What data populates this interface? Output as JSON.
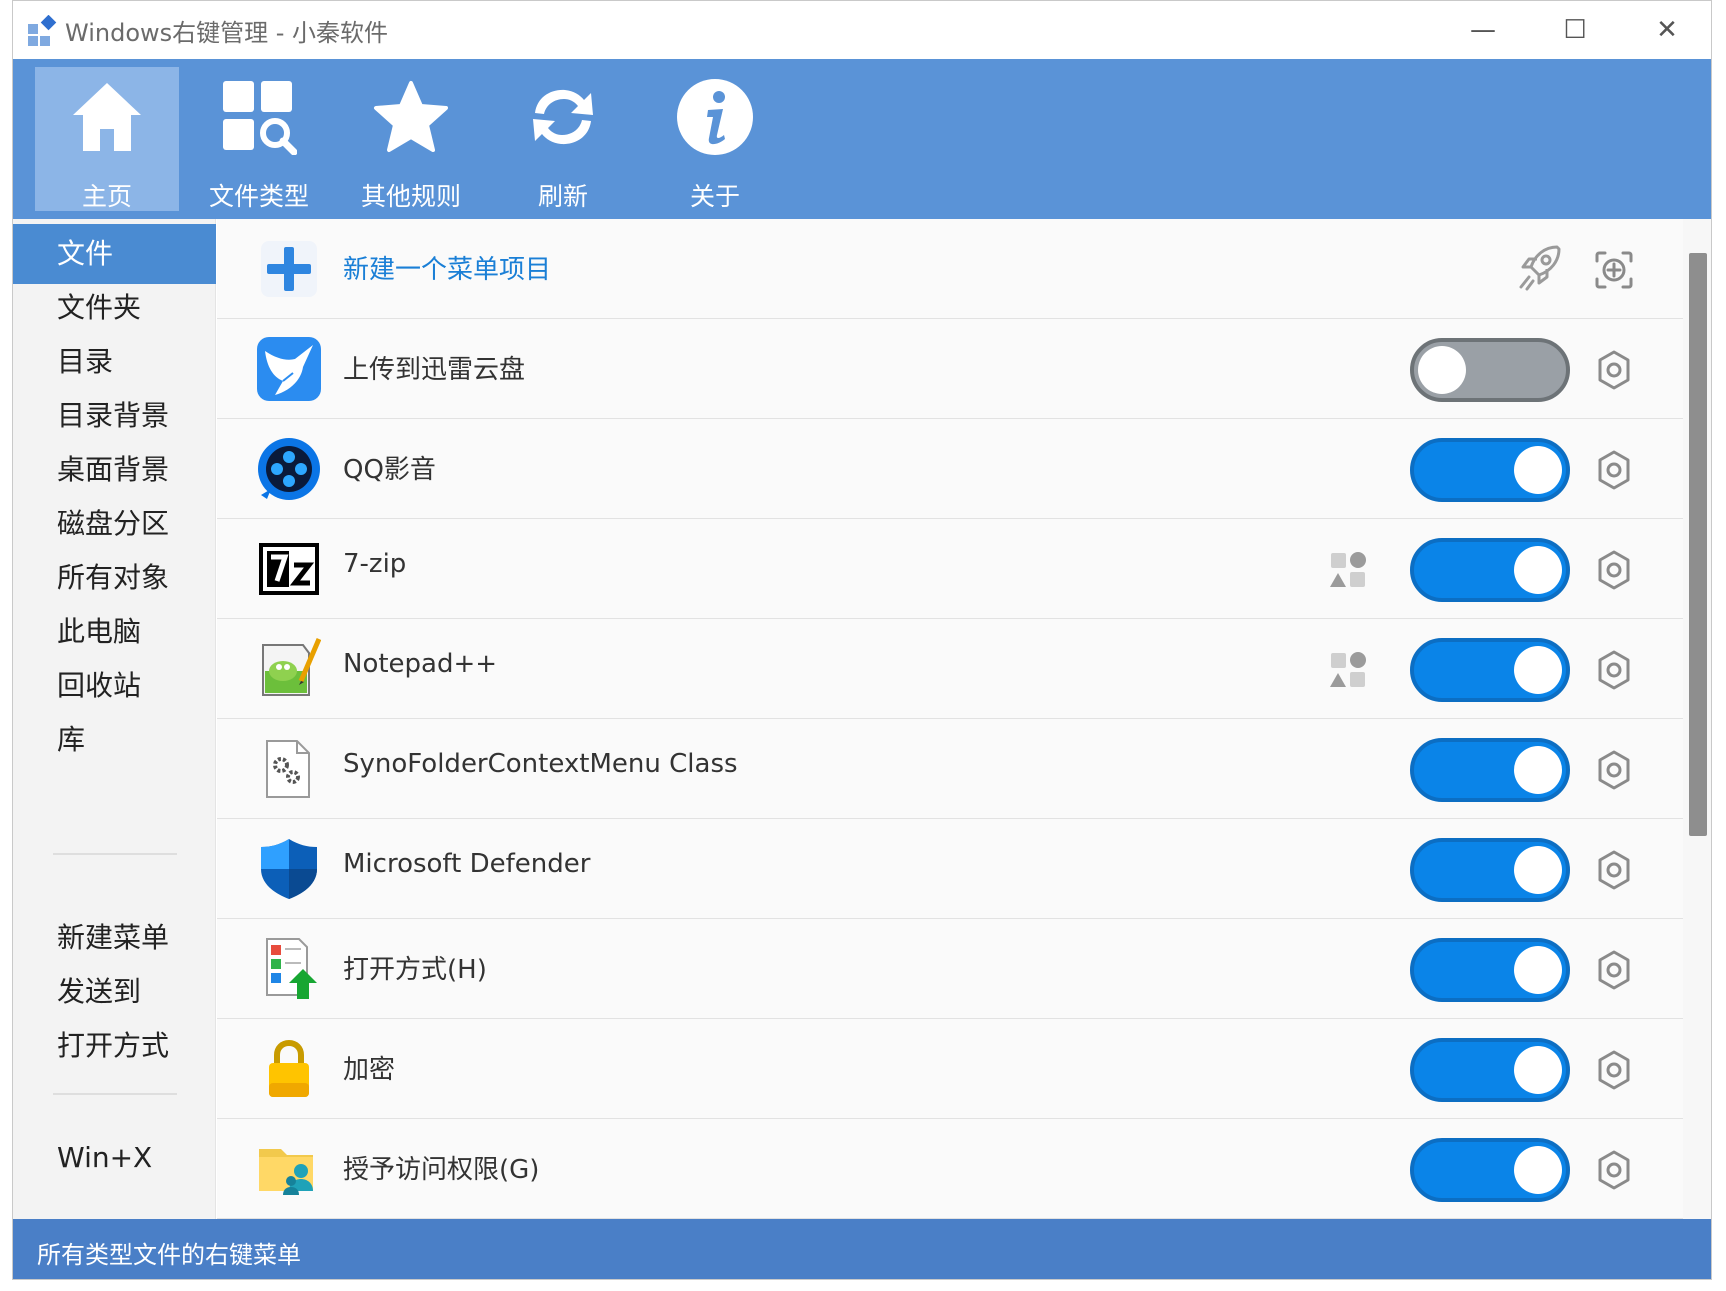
{
  "window": {
    "title": "Windows右键管理 - 小秦软件",
    "minimize_glyph": "—",
    "maximize_glyph": "☐",
    "close_glyph": "✕"
  },
  "toolbar": {
    "items": [
      {
        "label": "主页",
        "icon": "home-icon",
        "active": true
      },
      {
        "label": "文件类型",
        "icon": "file-types-icon",
        "active": false
      },
      {
        "label": "其他规则",
        "icon": "star-icon",
        "active": false
      },
      {
        "label": "刷新",
        "icon": "refresh-icon",
        "active": false
      },
      {
        "label": "关于",
        "icon": "info-icon",
        "active": false
      }
    ]
  },
  "sidebar": {
    "items": [
      {
        "label": "文件",
        "active": true
      },
      {
        "label": "文件夹"
      },
      {
        "label": "目录"
      },
      {
        "label": "目录背景"
      },
      {
        "label": "桌面背景"
      },
      {
        "label": "磁盘分区"
      },
      {
        "label": "所有对象"
      },
      {
        "label": "此电脑"
      },
      {
        "label": "回收站"
      },
      {
        "label": "库"
      },
      {
        "label": "新建菜单"
      },
      {
        "label": "发送到"
      },
      {
        "label": "打开方式"
      },
      {
        "label": "Win+X"
      }
    ]
  },
  "main": {
    "new_item_label": "新建一个菜单项目",
    "rows": [
      {
        "label": "上传到迅雷云盘",
        "icon": "thunder-bird-icon",
        "enabled": false,
        "extra": false
      },
      {
        "label": "QQ影音",
        "icon": "qq-player-icon",
        "enabled": true,
        "extra": false
      },
      {
        "label": "7-zip",
        "icon": "7zip-icon",
        "enabled": true,
        "extra": true
      },
      {
        "label": "Notepad++",
        "icon": "notepad-plus-plus-icon",
        "enabled": true,
        "extra": true
      },
      {
        "label": "SynoFolderContextMenu Class",
        "icon": "gear-document-icon",
        "enabled": true,
        "extra": false
      },
      {
        "label": "Microsoft Defender",
        "icon": "defender-shield-icon",
        "enabled": true,
        "extra": false
      },
      {
        "label": "打开方式(H)",
        "icon": "open-with-icon",
        "enabled": true,
        "extra": false
      },
      {
        "label": "加密",
        "icon": "lock-icon",
        "enabled": true,
        "extra": false
      },
      {
        "label": "授予访问权限(G)",
        "icon": "share-folder-icon",
        "enabled": true,
        "extra": false
      }
    ]
  },
  "status": {
    "text": "所有类型文件的右键菜单"
  },
  "colors": {
    "toolbar_bg": "#5a93d7",
    "toggle_on": "#0a84e8",
    "toggle_off": "#9aa0a6",
    "status_bg": "#4a7fc7",
    "sidebar_active": "#4a8bd2"
  }
}
